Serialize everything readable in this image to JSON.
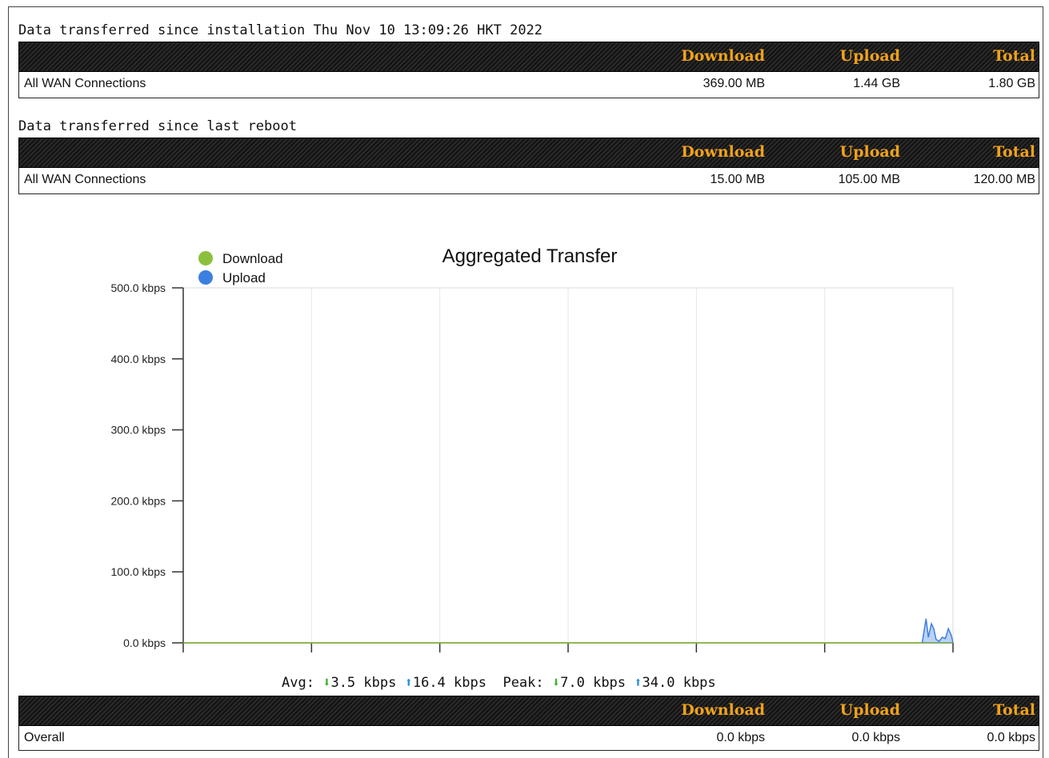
{
  "install_section": {
    "title": "Data transferred since installation Thu Nov 10 13:09:26 HKT 2022",
    "headers": {
      "download": "Download",
      "upload": "Upload",
      "total": "Total"
    },
    "row": {
      "name": "All WAN Connections",
      "download": "369.00 MB",
      "upload": "1.44 GB",
      "total": "1.80 GB"
    }
  },
  "reboot_section": {
    "title": "Data transferred since last reboot",
    "headers": {
      "download": "Download",
      "upload": "Upload",
      "total": "Total"
    },
    "row": {
      "name": "All WAN Connections",
      "download": "15.00 MB",
      "upload": "105.00 MB",
      "total": "120.00 MB"
    }
  },
  "chart_data": {
    "type": "area",
    "title": "Aggregated Transfer",
    "legend": [
      "Download",
      "Upload"
    ],
    "legend_position": "top-left",
    "y_ticks": [
      "0.0 kbps",
      "100.0 kbps",
      "200.0 kbps",
      "300.0 kbps",
      "400.0 kbps",
      "500.0 kbps"
    ],
    "ylim": [
      0,
      500
    ],
    "grid": true,
    "colors": {
      "download": "#8cc03c",
      "upload": "#3d7fe0"
    },
    "series": [
      {
        "name": "Download",
        "x": [
          0,
          1
        ],
        "values": [
          0,
          0
        ]
      },
      {
        "name": "Upload",
        "x": [
          0.96,
          0.965,
          0.968,
          0.972,
          0.975,
          0.978,
          0.982,
          0.986,
          0.99,
          0.994,
          0.998,
          1.0
        ],
        "values": [
          0,
          34,
          8,
          27,
          20,
          5,
          2,
          8,
          6,
          20,
          10,
          0
        ]
      }
    ]
  },
  "stats": {
    "avg_label": "Avg:",
    "avg_down": "3.5 kbps",
    "avg_up": "16.4 kbps",
    "peak_label": "Peak:",
    "peak_down": "7.0 kbps",
    "peak_up": "34.0 kbps"
  },
  "overall_section": {
    "headers": {
      "download": "Download",
      "upload": "Upload",
      "total": "Total"
    },
    "row": {
      "name": "Overall",
      "download": "0.0 kbps",
      "upload": "0.0 kbps",
      "total": "0.0 kbps"
    }
  }
}
